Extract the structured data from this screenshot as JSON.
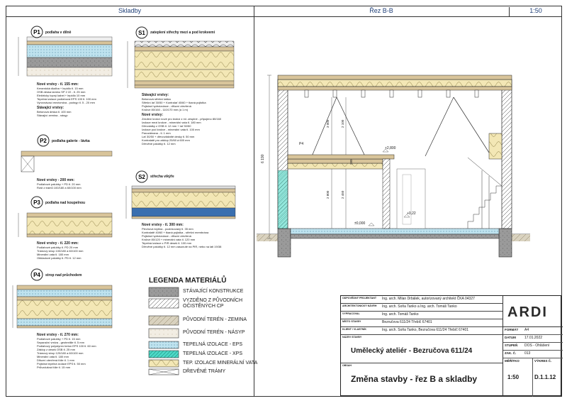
{
  "headers": {
    "left": "Skladby",
    "right": "Řez B-B",
    "scale": "1:50"
  },
  "sections": [
    {
      "code": "P1",
      "title": "podlaha v dílně",
      "lines": [
        "Nové vrstvy - tl. 155 mm:",
        "Keramická dlažba + lepidlo tl. 15 mm",
        "OSB deska lamino SP 2 22 - tl. 25 mm",
        "Elektricky topný kabel + lepidlo 10 mm",
        "Tepelná izolace podlahová EPS 100 tl. 100 mm",
        "Vyrovnávací mezivrstva - podsyp tl. 5 - 20 mm",
        "Stávající vrstvy:",
        "Betonová deska tl. 100 mm",
        "Stávající zemina - násyp"
      ]
    },
    {
      "code": "P2",
      "title": "podlaha galerie - lávka",
      "lines": [
        "Nové vrstvy - 200 mm:",
        "Podlahové palubky + PD tl. 20 mm",
        "Rošt z trámů 100/180 a 60/100 mm"
      ]
    },
    {
      "code": "P3",
      "title": "podlaha nad koupelnou",
      "lines": [
        "Nové vrstvy - tl. 220 mm:",
        "Podlahové palubky tl. PD 20 mm",
        "Trámový strop 100/180 a 60/100 mm",
        "Minerální vata tl. 180 mm",
        "Obkladové palubky tl. PD tl. 12 mm"
      ]
    },
    {
      "code": "P4",
      "title": "strop nad průchodem",
      "lines": [
        "Nové vrstvy - tl. 270 mm:",
        "Podlahové palubky + PD tl. 15 mm",
        "Separační vrstva - geotextilie tl. 5 mm",
        "Podlahový polystyren beton EPS 100 tl. 60 mm",
        "Záklop z desek OSB tl. 25 mm",
        "Trámový strop 120/180 a 60/100 mm",
        "Minerální vata tl. 180 mm",
        "Difuzní otevřená fólie tl. 1 mm",
        "Pojistná tepelná izolace EPS tl. 50 mm",
        "Průvzdušná fólie tl. 15 mm"
      ]
    },
    {
      "code": "S1",
      "title": "zateplení střechy mezi a pod krokvemi",
      "lines": [
        "Stávající vrstvy:",
        "Betonová střešní taška",
        "Střešní lať 30/50 + Kontralať 40/60 + tkaná pojistka",
        "Pojistná hydroizolace - difuzní otevřená",
        "Krokve 80/160 - 110/170 mm (á 1 m)",
        "Nové vrstvy:",
        "Zesílení krokví nové pro krokvi z ml. zesplné - připojeno 80/160",
        "Izolace mezi krokve - minerální vata tl. 180 mm",
        "Dřevolatky z OSB tl. 12 mm + lať 30/50",
        "Izolace pod krokve - minerální vata tl. 100 mm",
        "Parozábrana - tl. 1 mm",
        "Lať 30/50 + dřevovláknité desky tl. 50 mm",
        "Kontralatě pro záklop 20/60 á 600 mm",
        "Dřevěné palubky tl. 12 mm"
      ]
    },
    {
      "code": "S2",
      "title": "střecha vikýře",
      "lines": [
        "Nové vrstvy - tl. 300 mm:",
        "Plechová krytina - pozinkovaný tl. 35 mm",
        "Kontralatě 40/60 + tkaná pojistka - střešní membrána",
        "Pojistná hydroizolace - difuzní otevřená",
        "Krokve 80/120 + minerální vata tl. 120 mm",
        "Tepelná izolace z PIR desek tl. 100 mm",
        "Dřevěné palubky tl. 12 mm zasunuté na PIR, nebo na lati 19/38"
      ]
    }
  ],
  "legend": {
    "title": "LEGENDA MATERIÁLŮ",
    "items": [
      {
        "label": "STÁVAJÍCÍ KONSTRUKCE",
        "color": "#8a8a8a"
      },
      {
        "label": "VYZDĚNO Z PŮVODNÍCH\nOČISTĚNÝCH CP",
        "color": "#ffffff"
      },
      {
        "label": "PŮVODNÍ TERÉN - ZEMINA",
        "color": "#d9d2bf"
      },
      {
        "label": "PŮVODNÍ TERÉN - NÁSYP",
        "color": "#f2ede3"
      },
      {
        "label": "TEPELNÁ IZOLACE - EPS",
        "color": "#bfe3ef"
      },
      {
        "label": "TEPELNÁ IZOLACE - XPS",
        "color": "#4dd9c7"
      },
      {
        "label": "TEP. IZOLACE MINERÁLNÍ VATA",
        "color": "#f3e7b5"
      },
      {
        "label": "DŘEVĚNÉ TRÁMY",
        "color": "#ffffff"
      }
    ]
  },
  "section_view": {
    "labels": [
      "P4",
      "+2,800",
      "±0,000",
      "+0,22",
      "S2"
    ],
    "dims": [
      "6 190",
      "3 000",
      "2 100",
      "2 800",
      "2 450",
      "280",
      "20",
      "40",
      "220",
      "200"
    ]
  },
  "title_block": {
    "rows": [
      {
        "key": "ODPOVĚDNÝ PROJEKTANT",
        "value": "Ing. arch. Milan Drbálek, autorizovaný architekt ČKA 04327"
      },
      {
        "key": "ARCHITEKTONICKÝ NÁVRH",
        "value": "Ing. arch. Soňa Tanko  a  Ing. arch. Tomáš Tanko"
      },
      {
        "key": "VYPRACOVAL",
        "value": "Ing. arch. Tomáš Tanko"
      },
      {
        "key": "MÍSTO STAVBY",
        "value": "Bezručova 611/24 Třebíč 67401"
      },
      {
        "key": "KLIENT / VLASTNÍK",
        "value": "Ing. arch. Soňa Tanko, Bezručova 611/24 Třebíč 67401"
      }
    ],
    "stavba_key": "NÁZEV STAVBY",
    "stavba": "Umělecký ateliér - Bezručova 611/24",
    "obsah_key": "OBSAH",
    "obsah": "Změna stavby - řez B a skladby",
    "logo": "ARDI",
    "meta": [
      {
        "key": "FORMÁT",
        "value": "A4"
      },
      {
        "key": "DATUM",
        "value": "17.01.2022"
      },
      {
        "key": "STUPEŇ",
        "value": "DOS - Ohlášení"
      },
      {
        "key": "ZAK. Č.",
        "value": "013"
      }
    ],
    "scale_key": "MĚŘÍTKO",
    "scale": "1:50",
    "sheet_key": "VÝKRES Č.",
    "sheet": "D.1.1.12"
  }
}
